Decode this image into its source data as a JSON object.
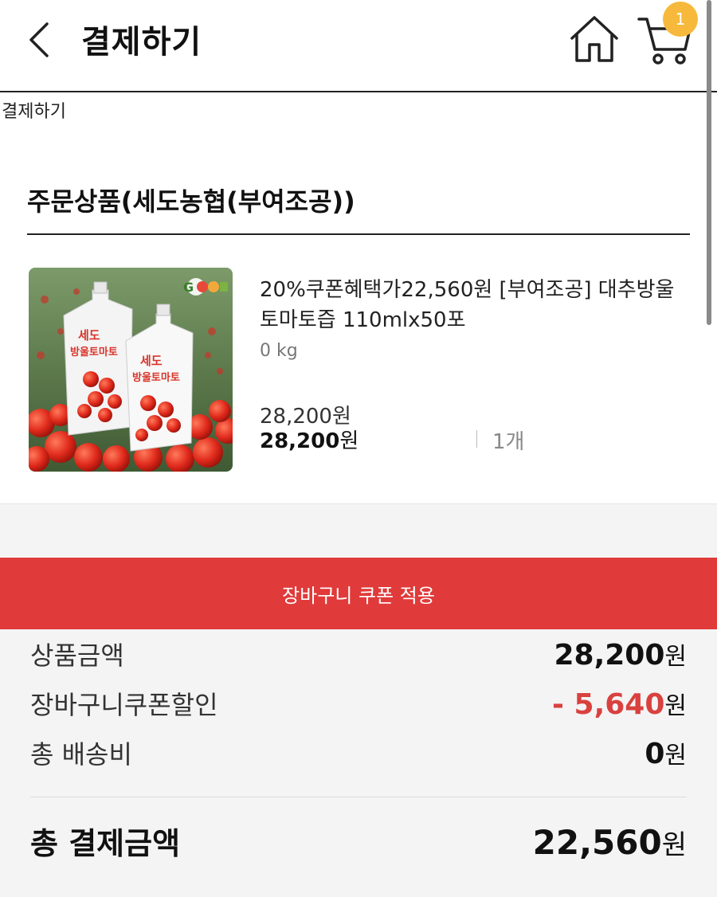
{
  "header": {
    "title": "결제하기",
    "cart_count": "1"
  },
  "breadcrumb": "결제하기",
  "order": {
    "section_title": "주문상품(세도농협(부여조공))",
    "product": {
      "name": "20%쿠폰혜택가22,560원 [부여조공] 대추방울토마토즙 110mlx50포",
      "weight": "0 kg",
      "price_original": "28,200원",
      "price_final_amount": "28,200",
      "price_final_unit": "원",
      "quantity": "1개",
      "image_label_line1": "세도",
      "image_label_line2": "방울토마토",
      "image_brand": "GOOD"
    }
  },
  "coupon_button_label": "장바구니 쿠폰 적용",
  "summary": {
    "subtotal_label": "상품금액",
    "subtotal_amount": "28,200",
    "discount_label": "장바구니쿠폰할인",
    "discount_sign": "- ",
    "discount_amount": "5,640",
    "shipping_label": "총 배송비",
    "shipping_amount": "0",
    "unit": "원",
    "total_label": "총 결제금액",
    "total_amount": "22,560"
  },
  "colors": {
    "accent_red": "#e03a3a",
    "discount_red": "#d9413f",
    "badge": "#f6b93b"
  }
}
